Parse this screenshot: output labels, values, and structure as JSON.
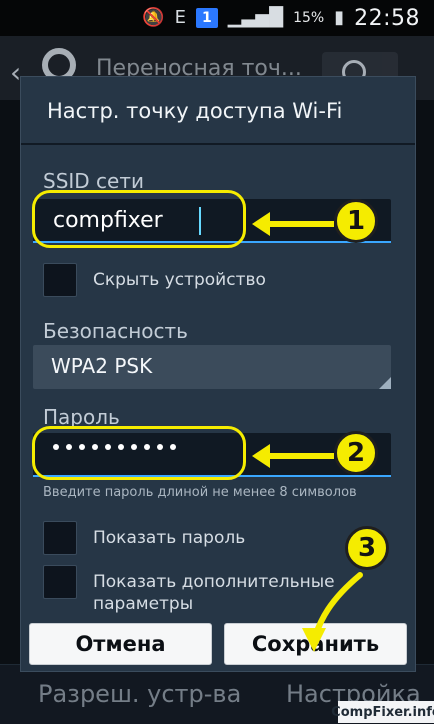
{
  "status_bar": {
    "battery_pct": "15%",
    "time": "22:58",
    "sim_badge": "1",
    "network_label": "E",
    "icons": [
      "mute-icon",
      "sim-badge-icon",
      "signal-icon",
      "battery-icon"
    ]
  },
  "background": {
    "header_title": "Переносная точ...",
    "bottom_left": "Разреш. устр-ва",
    "bottom_right": "Настройка"
  },
  "dialog": {
    "title": "Настр. точку доступа Wi-Fi",
    "ssid_label": "SSID сети",
    "ssid_value": "compfixer",
    "hide_device_label": "Скрыть устройство",
    "security_label": "Безопасность",
    "security_value": "WPA2 PSK",
    "password_label": "Пароль",
    "password_dots_count": 10,
    "password_hint": "Введите пароль длиной не менее 8 символов",
    "show_password_label": "Показать пароль",
    "show_advanced_label": "Показать дополнительные\nпараметры",
    "buttons": {
      "cancel": "Отмена",
      "save": "Сохранить"
    }
  },
  "annotations": {
    "step_1": "1",
    "step_2": "2",
    "step_3": "3",
    "color": "#f5ec00"
  },
  "watermark": "CompFixer.info"
}
